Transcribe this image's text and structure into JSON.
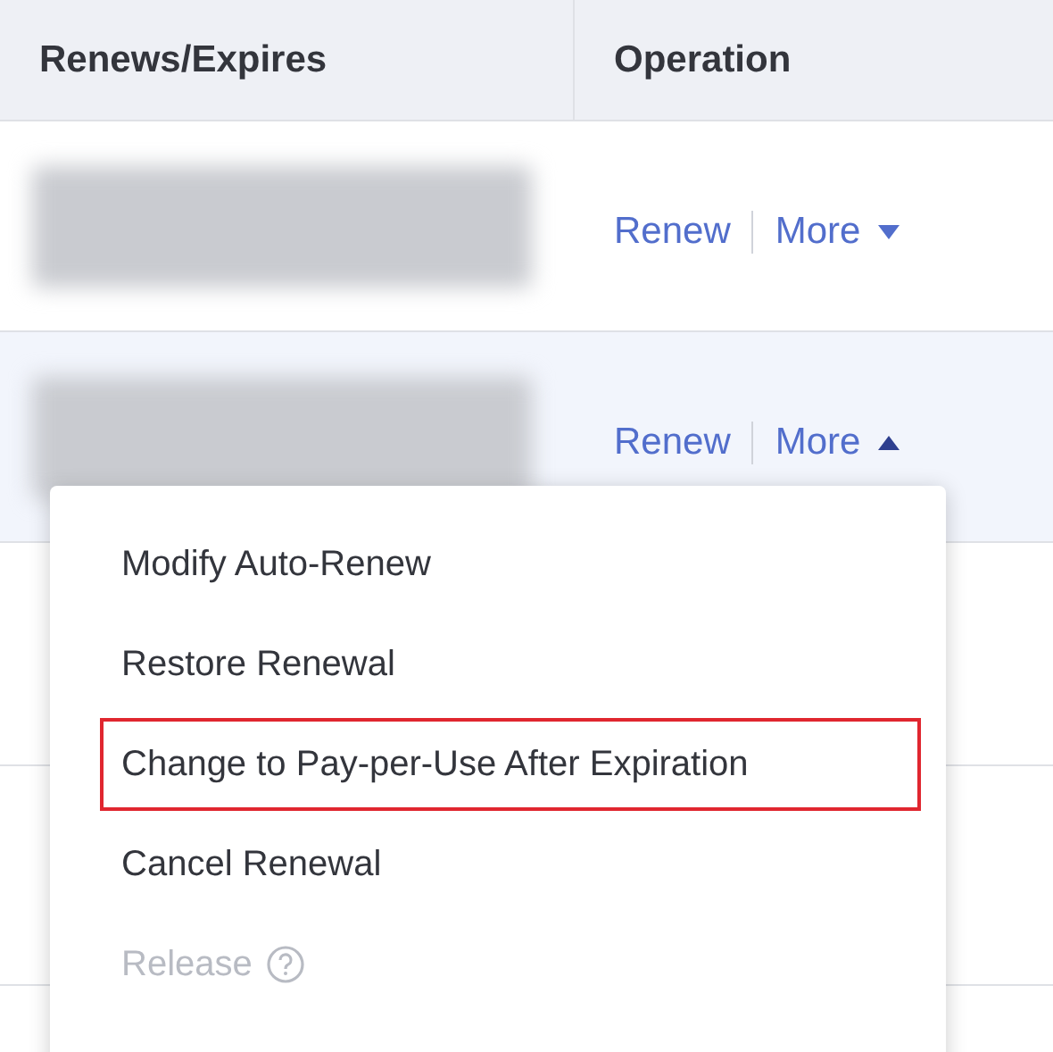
{
  "table": {
    "columns": [
      {
        "label": "Renews/Expires"
      },
      {
        "label": "Operation"
      }
    ],
    "rows": [
      {
        "actions": [
          {
            "label": "Renew"
          },
          {
            "label": "More",
            "expanded": false
          }
        ],
        "hovered": false
      },
      {
        "actions": [
          {
            "label": "Renew"
          },
          {
            "label": "More",
            "expanded": true
          }
        ],
        "hovered": true
      }
    ]
  },
  "menu": {
    "items": [
      {
        "label": "Modify Auto-Renew",
        "disabled": false,
        "highlighted": false,
        "help": false
      },
      {
        "label": "Restore Renewal",
        "disabled": false,
        "highlighted": false,
        "help": false
      },
      {
        "label": "Change to Pay-per-Use After Expiration",
        "disabled": false,
        "highlighted": true,
        "help": false
      },
      {
        "label": "Cancel Renewal",
        "disabled": false,
        "highlighted": false,
        "help": false
      },
      {
        "label": "Release",
        "disabled": true,
        "highlighted": false,
        "help": true
      }
    ]
  }
}
